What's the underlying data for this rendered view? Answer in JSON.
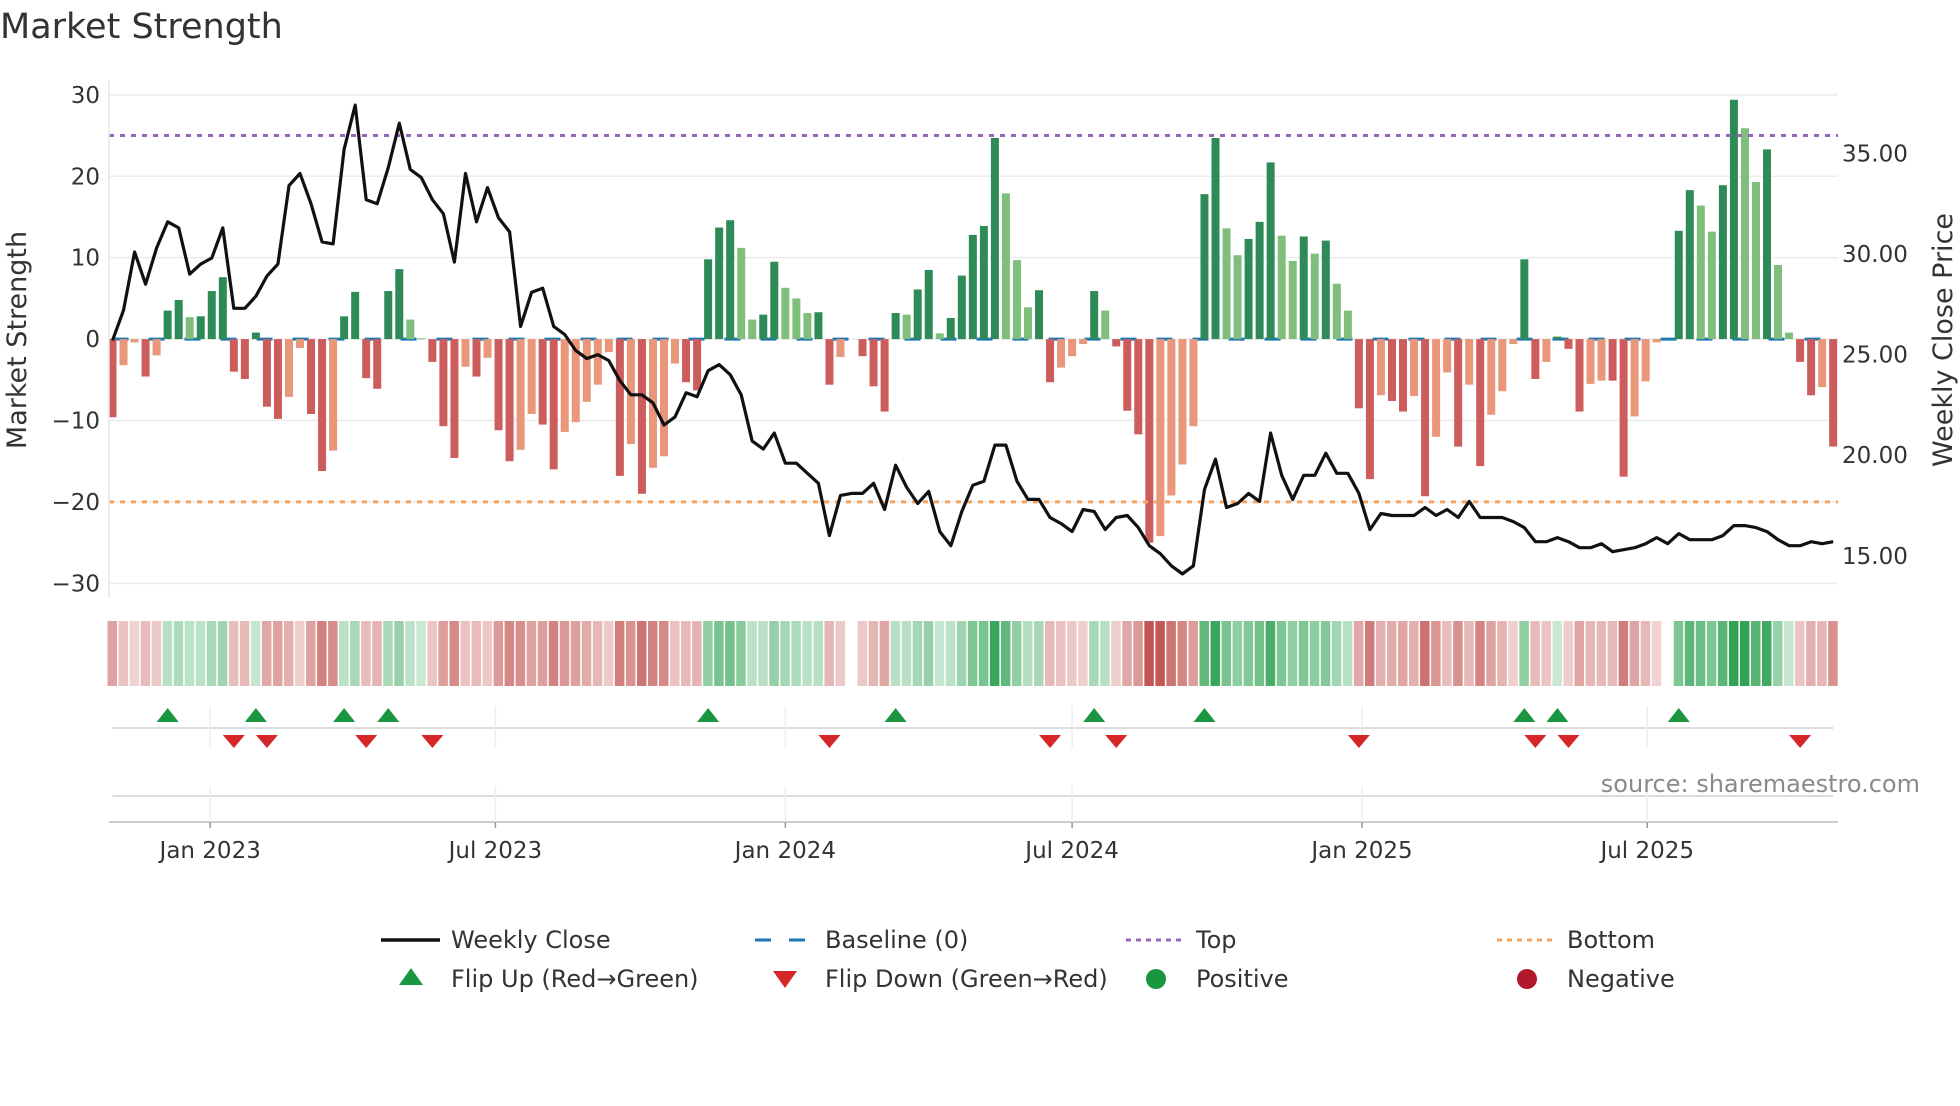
{
  "chart_data": {
    "type": "bar",
    "title": "Market Strength",
    "ylabel": "Market Strength",
    "y2label": "Weekly Close Price",
    "start_date": "2022-10-31",
    "interval_days": 7,
    "ylim": [
      -31.8,
      31.7
    ],
    "y2lim": [
      12.9,
      38.6
    ],
    "yticks": [
      30,
      20,
      10,
      0,
      -10,
      -20,
      -30
    ],
    "ytick_labels": [
      "30",
      "20",
      "10",
      "0",
      "−10",
      "−20",
      "−30"
    ],
    "y2ticks": [
      35,
      30,
      25,
      20,
      15
    ],
    "y2tick_labels": [
      "35.00",
      "30.00",
      "25.00",
      "20.00",
      "15.00"
    ],
    "xticks": [
      {
        "date": "2023-01-01",
        "label": "Jan 2023"
      },
      {
        "date": "2023-07-01",
        "label": "Jul 2023"
      },
      {
        "date": "2024-01-01",
        "label": "Jan 2024"
      },
      {
        "date": "2024-07-01",
        "label": "Jul 2024"
      },
      {
        "date": "2025-01-01",
        "label": "Jan 2025"
      },
      {
        "date": "2025-07-01",
        "label": "Jul 2025"
      }
    ],
    "grid": true,
    "top_threshold": 25,
    "bottom_threshold": -20,
    "baseline": 0,
    "strength": [
      -9.6,
      -3.2,
      -0.4,
      -4.6,
      -2,
      3.5,
      4.8,
      2.7,
      2.8,
      5.9,
      7.6,
      -4,
      -4.9,
      0.8,
      -8.3,
      -9.8,
      -7.1,
      -1.1,
      -9.2,
      -16.2,
      -13.7,
      2.8,
      5.8,
      -4.8,
      -6.1,
      5.9,
      8.6,
      2.4,
      0.1,
      -2.8,
      -10.7,
      -14.6,
      -3.4,
      -4.6,
      -2.3,
      -11.2,
      -15,
      -13.6,
      -9.2,
      -10.5,
      -16,
      -11.4,
      -10.2,
      -7.7,
      -5.6,
      -1.6,
      -16.8,
      -12.9,
      -19,
      -15.8,
      -14.4,
      -3,
      -5.3,
      -6.3,
      9.8,
      13.7,
      14.6,
      11.2,
      2.4,
      3,
      9.5,
      6.3,
      5,
      3.2,
      3.3,
      -5.6,
      -2.2,
      0,
      -2.1,
      -5.8,
      -8.9,
      3.2,
      3,
      6.1,
      8.5,
      0.7,
      2.6,
      7.8,
      12.8,
      13.9,
      24.7,
      17.9,
      9.7,
      3.9,
      6,
      -5.3,
      -3.5,
      -2.1,
      -0.6,
      5.9,
      3.5,
      -0.9,
      -8.8,
      -11.7,
      -25,
      -24.2,
      -19.2,
      -15.4,
      -10.7,
      17.8,
      24.7,
      13.6,
      10.3,
      12.3,
      14.4,
      21.7,
      12.7,
      9.6,
      12.6,
      10.5,
      12.1,
      6.8,
      3.5,
      -8.5,
      -17.2,
      -6.9,
      -7.6,
      -8.9,
      -7,
      -19.3,
      -12,
      -4.1,
      -13.2,
      -5.6,
      -15.6,
      -9.3,
      -6.4,
      -0.6,
      9.8,
      -4.9,
      -2.8,
      0.3,
      -1.2,
      -8.9,
      -5.5,
      -5.1,
      -5.1,
      -16.9,
      -9.5,
      -5.2,
      -0.4,
      0,
      13.3,
      18.3,
      16.4,
      13.2,
      18.9,
      29.4,
      25.9,
      19.3,
      23.3,
      9.1,
      0.8,
      -2.8,
      -6.9,
      -5.9,
      -13.2
    ],
    "weekly_close": [
      25.7,
      27.2,
      30.1,
      28.5,
      30.3,
      31.6,
      31.3,
      29.0,
      29.5,
      29.8,
      31.3,
      27.3,
      27.3,
      27.9,
      28.9,
      29.5,
      33.4,
      34.0,
      32.5,
      30.6,
      30.5,
      35.2,
      37.4,
      32.7,
      32.5,
      34.3,
      36.5,
      34.2,
      33.8,
      32.7,
      32.0,
      29.6,
      34.0,
      31.6,
      33.3,
      31.8,
      31.1,
      26.4,
      28.1,
      28.3,
      26.4,
      26.0,
      25.2,
      24.8,
      25.0,
      24.7,
      23.7,
      23.0,
      23.0,
      22.6,
      21.5,
      21.9,
      23.1,
      22.9,
      24.2,
      24.5,
      24.0,
      23.0,
      20.7,
      20.3,
      21.1,
      19.6,
      19.6,
      19.1,
      18.6,
      16.0,
      18.0,
      18.1,
      18.1,
      18.6,
      17.3,
      19.5,
      18.4,
      17.6,
      18.2,
      16.2,
      15.5,
      17.2,
      18.5,
      18.7,
      20.5,
      20.5,
      18.7,
      17.8,
      17.8,
      16.9,
      16.6,
      16.2,
      17.3,
      17.2,
      16.3,
      16.9,
      17.0,
      16.4,
      15.5,
      15.1,
      14.5,
      14.1,
      14.5,
      18.3,
      19.8,
      17.4,
      17.6,
      18.1,
      17.7,
      21.1,
      19.0,
      17.8,
      19.0,
      19.0,
      20.1,
      19.1,
      19.1,
      18.1,
      16.3,
      17.1,
      17.0,
      17.0,
      17.0,
      17.4,
      17.0,
      17.3,
      16.9,
      17.7,
      16.9,
      16.9,
      16.9,
      16.7,
      16.4,
      15.7,
      15.7,
      15.9,
      15.7,
      15.4,
      15.4,
      15.6,
      15.2,
      15.3,
      15.4,
      15.6,
      15.9,
      15.6,
      16.1,
      15.8,
      15.8,
      15.8,
      16.0,
      16.5,
      16.5,
      16.4,
      16.2,
      15.8,
      15.5,
      15.5,
      15.7,
      15.6,
      15.7
    ],
    "colors": {
      "positive_strong": "#2e8b57",
      "positive_weak": "#7fbf7b",
      "negative_strong": "#cd5c5c",
      "negative_weak": "#e9967a",
      "baseline": "#1f77b4",
      "top": "#9467bd",
      "bottom": "#f4a460",
      "price": "#111111",
      "flip_up": "#1a9641",
      "flip_down": "#d62728",
      "heat_pos": "#31a354",
      "heat_neg": "#c0504d"
    },
    "legend": {
      "placement": "bottom",
      "items": [
        {
          "label": "Weekly Close",
          "marker": "line"
        },
        {
          "label": "Baseline (0)",
          "marker": "dash"
        },
        {
          "label": "Top",
          "marker": "dotted"
        },
        {
          "label": "Bottom",
          "marker": "dotted"
        },
        {
          "label": "Flip Up (Red→Green)",
          "marker": "triangle-up"
        },
        {
          "label": "Flip Down (Green→Red)",
          "marker": "triangle-down"
        },
        {
          "label": "Positive",
          "marker": "circle"
        },
        {
          "label": "Negative",
          "marker": "circle"
        }
      ]
    },
    "source": "source: sharemaestro.com"
  }
}
